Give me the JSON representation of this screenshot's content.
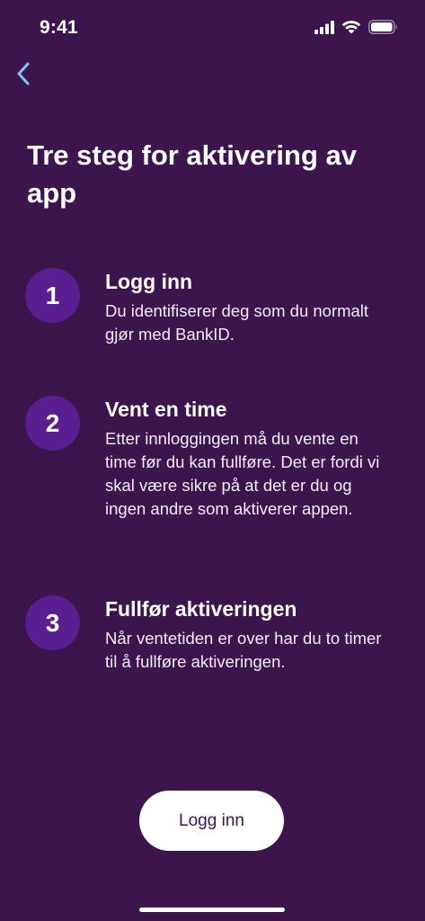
{
  "status_bar": {
    "time": "9:41",
    "icons": [
      "cellular-signal-icon",
      "wifi-icon",
      "battery-icon"
    ]
  },
  "nav": {
    "back_icon": "chevron-left-icon",
    "back_color": "#7cc3ef"
  },
  "page": {
    "title": "Tre steg for aktivering av app"
  },
  "steps": [
    {
      "number": "1",
      "title": "Logg inn",
      "description": "Du identifiserer deg som du normalt gjør med BankID."
    },
    {
      "number": "2",
      "title": "Vent en time",
      "description": "Etter innloggingen må du vente en time før du kan fullføre. Det er fordi vi skal være sikre på at det er du og ingen andre som aktiverer appen."
    },
    {
      "number": "3",
      "title": "Fullfør aktiveringen",
      "description": "Når ventetiden er over har du to timer til å fullføre aktiveringen."
    }
  ],
  "actions": {
    "primary_label": "Logg inn"
  },
  "colors": {
    "background": "#3b154c",
    "step_circle": "#5b1e91",
    "button_bg": "#ffffff",
    "button_text": "#3b154c"
  }
}
